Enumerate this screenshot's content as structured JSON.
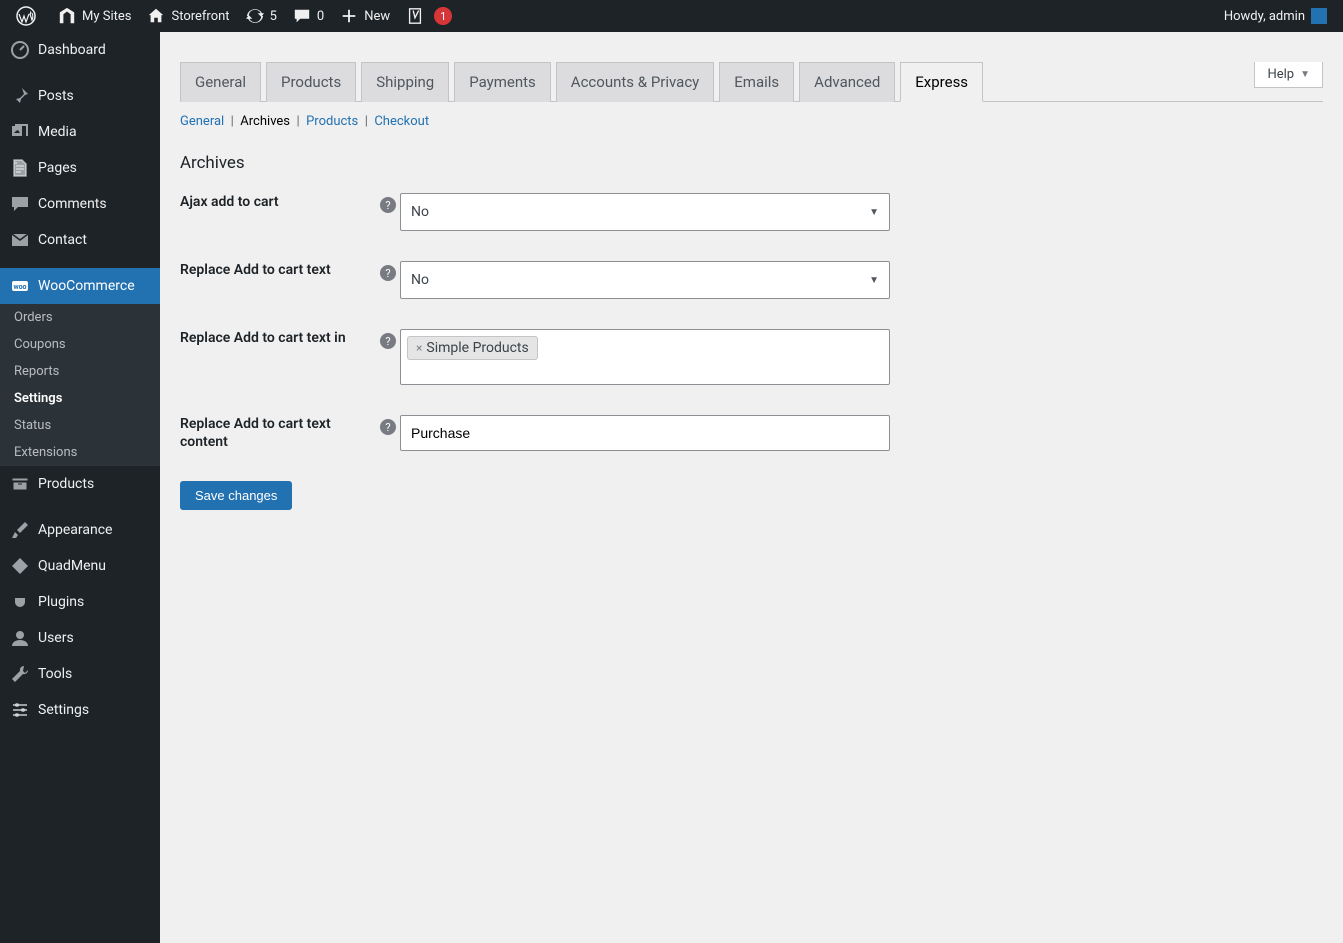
{
  "adminbar": {
    "my_sites": "My Sites",
    "site_name": "Storefront",
    "updates_count": "5",
    "comments_count": "0",
    "new_label": "New",
    "yoast_count": "1",
    "howdy": "Howdy, admin"
  },
  "sidebar": {
    "items": [
      {
        "label": "Dashboard",
        "icon": "dashboard"
      },
      {
        "label": "Posts",
        "icon": "pin"
      },
      {
        "label": "Media",
        "icon": "media"
      },
      {
        "label": "Pages",
        "icon": "pages"
      },
      {
        "label": "Comments",
        "icon": "comment"
      },
      {
        "label": "Contact",
        "icon": "mail"
      },
      {
        "label": "WooCommerce",
        "icon": "woo",
        "current": true
      },
      {
        "label": "Products",
        "icon": "archive"
      },
      {
        "label": "Appearance",
        "icon": "brush"
      },
      {
        "label": "QuadMenu",
        "icon": "diamond"
      },
      {
        "label": "Plugins",
        "icon": "plug"
      },
      {
        "label": "Users",
        "icon": "user"
      },
      {
        "label": "Tools",
        "icon": "wrench"
      },
      {
        "label": "Settings",
        "icon": "sliders"
      }
    ],
    "submenu": [
      {
        "label": "Orders"
      },
      {
        "label": "Coupons"
      },
      {
        "label": "Reports"
      },
      {
        "label": "Settings",
        "current": true
      },
      {
        "label": "Status"
      },
      {
        "label": "Extensions"
      }
    ]
  },
  "help_label": "Help",
  "tabs": [
    "General",
    "Products",
    "Shipping",
    "Payments",
    "Accounts & Privacy",
    "Emails",
    "Advanced",
    "Express"
  ],
  "active_tab": "Express",
  "subtabs": [
    {
      "label": "General"
    },
    {
      "label": "Archives",
      "current": true
    },
    {
      "label": "Products"
    },
    {
      "label": "Checkout"
    }
  ],
  "section_title": "Archives",
  "fields": {
    "ajax_add_to_cart": {
      "label": "Ajax add to cart",
      "value": "No"
    },
    "replace_text": {
      "label": "Replace Add to cart text",
      "value": "No"
    },
    "replace_text_in": {
      "label": "Replace Add to cart text in",
      "chip": "Simple Products"
    },
    "replace_text_content": {
      "label": "Replace Add to cart text content",
      "value": "Purchase"
    }
  },
  "save_label": "Save changes"
}
